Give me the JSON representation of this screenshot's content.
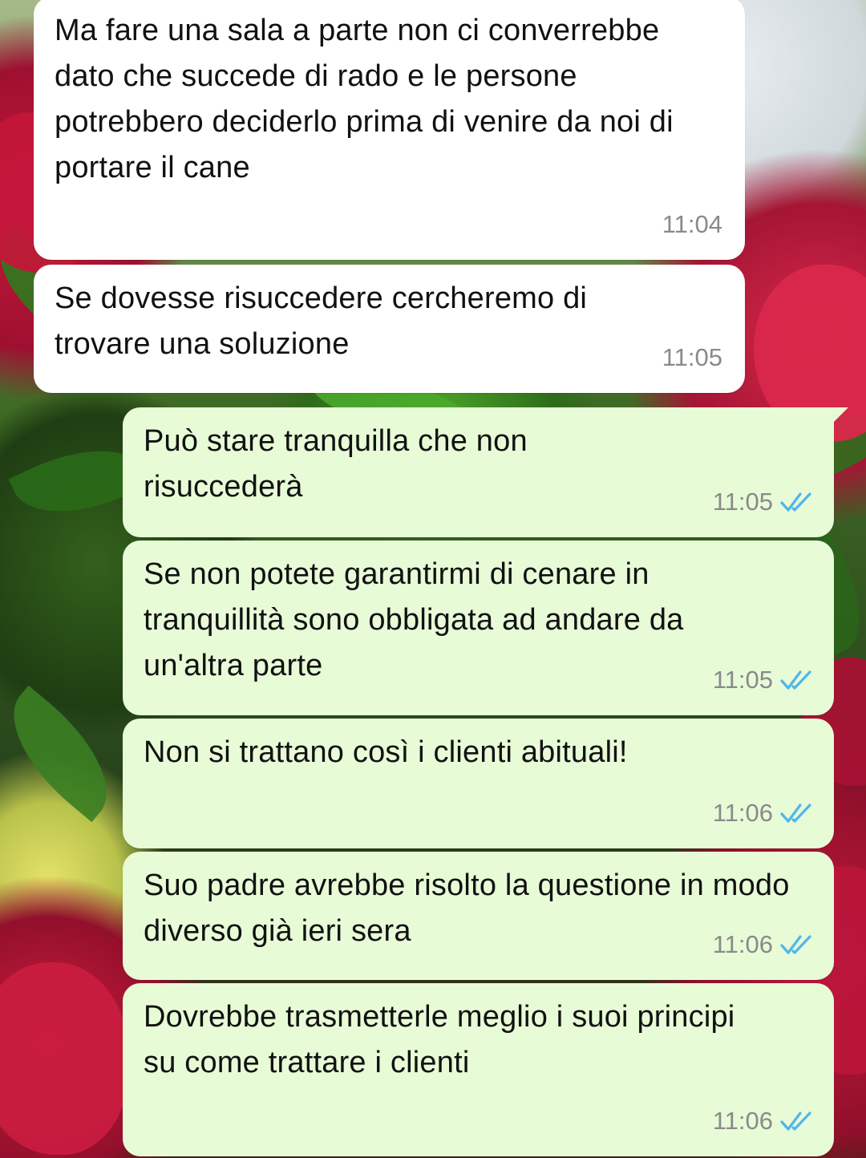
{
  "messages": [
    {
      "direction": "incoming",
      "text": "Ma fare una sala a parte non ci converrebbe dato che succede di rado e le persone potrebbero deciderlo prima di venire da noi di portare il cane",
      "time": "11:04"
    },
    {
      "direction": "incoming",
      "text": "Se dovesse risuccedere cercheremo di trovare una soluzione",
      "time": "11:05"
    },
    {
      "direction": "outgoing",
      "text": "Può stare tranquilla che non risuccederà",
      "time": "11:05",
      "status": "read"
    },
    {
      "direction": "outgoing",
      "text": "Se non potete garantirmi di cenare in tranquillità sono obbligata ad andare da un'altra parte",
      "time": "11:05",
      "status": "read"
    },
    {
      "direction": "outgoing",
      "text": "Non si trattano così i clienti abituali!",
      "time": "11:06",
      "status": "read"
    },
    {
      "direction": "outgoing",
      "text": "Suo padre avrebbe risolto la questione in modo diverso già ieri sera",
      "time": "11:06",
      "status": "read"
    },
    {
      "direction": "outgoing",
      "text": "Dovrebbe trasmetterle meglio i suoi principi su come trattare i clienti",
      "time": "11:06",
      "status": "read"
    }
  ],
  "colors": {
    "incoming_bubble": "#ffffff",
    "outgoing_bubble": "#e7fbd7",
    "read_ticks": "#4fb6ec",
    "timestamp": "#8a8a8a"
  },
  "icons": {
    "read_receipt": "double-check-icon"
  }
}
